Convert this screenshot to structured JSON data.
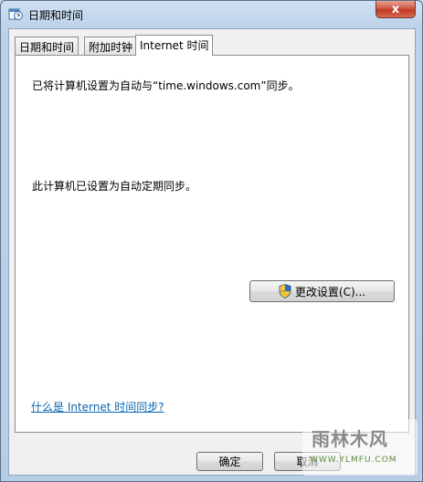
{
  "window": {
    "title": "日期和时间",
    "close_glyph": "x"
  },
  "tabs": [
    {
      "label": "日期和时间",
      "active": false
    },
    {
      "label": "附加时钟",
      "active": false
    },
    {
      "label": "Internet 时间",
      "active": true
    }
  ],
  "panel": {
    "sync_status": "已将计算机设置为自动与“time.windows.com”同步。",
    "auto_sync": "此计算机已设置为自动定期同步。",
    "change_settings_label": "更改设置(C)...",
    "help_link": "什么是 Internet 时间同步?"
  },
  "footer": {
    "ok_label": "确定",
    "cancel_label": "取消"
  },
  "watermark": {
    "text": "雨林木风",
    "url": "WWW.YLMFU.COM"
  },
  "icons": {
    "app": "clock-calendar-icon",
    "shield": "uac-shield-icon",
    "close": "close-icon"
  },
  "colors": {
    "link": "#0b64b0",
    "close_button": "#c03a24"
  }
}
